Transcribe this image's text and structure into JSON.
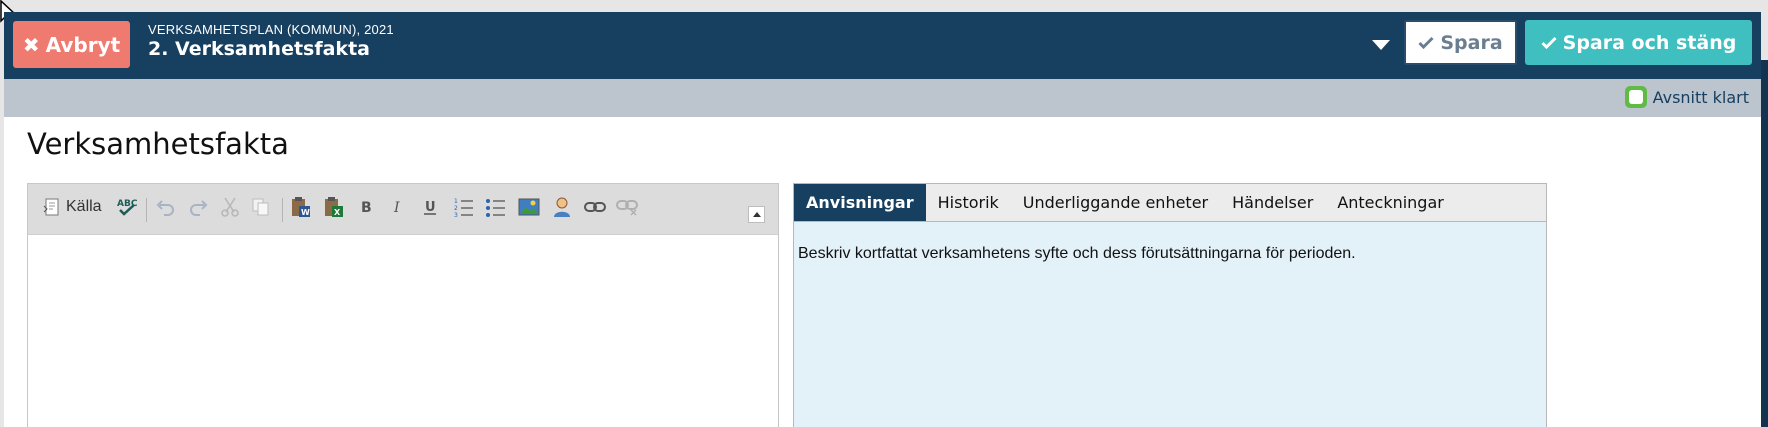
{
  "header": {
    "cancel_label": "Avbryt",
    "subtitle": "VERKSAMHETSPLAN (KOMMUN), 2021",
    "title": "2. Verksamhetsfakta",
    "save_label": "Spara",
    "save_close_label": "Spara och stäng"
  },
  "status": {
    "section_done_label": "Avsnitt klart",
    "section_done_checked": false
  },
  "page": {
    "section_title": "Verksamhetsfakta"
  },
  "editor": {
    "toolbar": {
      "source_label": "Källa",
      "items": [
        "Källa",
        "Stavningskontroll",
        "Ångra",
        "Gör om",
        "Klipp ut",
        "Kopiera",
        "Klistra in från Word",
        "Klistra in från Excel",
        "Fet",
        "Kursiv",
        "Understruken",
        "Numrerad lista",
        "Punktlista",
        "Bild",
        "Person",
        "Länk",
        "Ta bort länk"
      ]
    },
    "content": ""
  },
  "panel": {
    "tabs": [
      "Anvisningar",
      "Historik",
      "Underliggande enheter",
      "Händelser",
      "Anteckningar"
    ],
    "active_tab": "Anvisningar",
    "instructions": "Beskriv kortfattat verksamhetens syfte och dess förutsättningarna för perioden."
  },
  "colors": {
    "header_bg": "#173f60",
    "cancel_bg": "#ef7a6f",
    "save_close_bg": "#3fbfbf",
    "done_green": "#5fbb46",
    "panel_bg": "#e3f1f8"
  }
}
